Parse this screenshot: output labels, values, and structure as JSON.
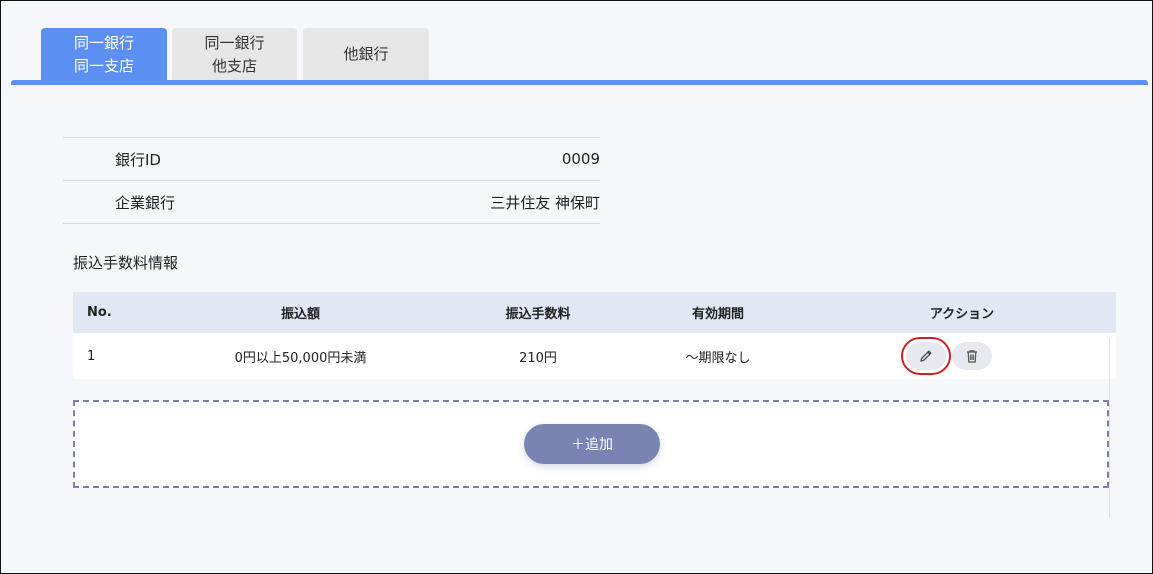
{
  "tabs": [
    {
      "line1": "同一銀行",
      "line2": "同一支店",
      "active": true
    },
    {
      "line1": "同一銀行",
      "line2": "他支店",
      "active": false
    },
    {
      "line1": "他銀行",
      "line2": "",
      "active": false
    }
  ],
  "bank_info": [
    {
      "label": "銀行ID",
      "value": "0009"
    },
    {
      "label": "企業銀行",
      "value": "三井住友 神保町"
    }
  ],
  "fee_section": {
    "title": "振込手数料情報",
    "columns": [
      "No.",
      "振込額",
      "振込手数料",
      "有効期間",
      "アクション"
    ],
    "rows": [
      {
        "no": "1",
        "amount": "0円以上50,000円未満",
        "fee": "210円",
        "period": "～期限なし"
      }
    ],
    "add_label": "＋追加"
  },
  "icons": {
    "edit": "pencil-icon",
    "delete": "trash-icon"
  },
  "colors": {
    "accent": "#5b8ff2",
    "header_bg": "#e3e7f4",
    "add_button": "#7a84b3",
    "highlight": "#d42020"
  }
}
